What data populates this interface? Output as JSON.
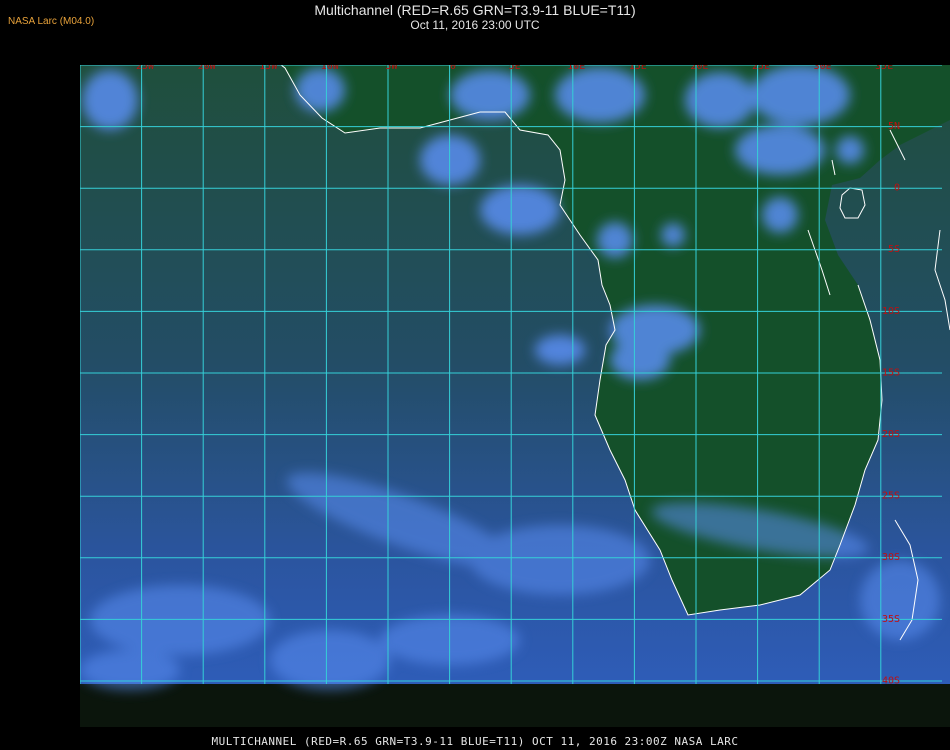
{
  "header": {
    "logo_text": "NASA Larc (M04.0)",
    "title_line1": "Multichannel (RED=R.65 GRN=T3.9-11 BLUE=T11)",
    "title_line2": "Oct 11, 2016 23:00 UTC"
  },
  "footer": {
    "caption": "MULTICHANNEL (RED=R.65 GRN=T3.9-11 BLUE=T11) OCT 11, 2016 23:00Z   NASA LARC"
  },
  "map": {
    "longitude_labels": [
      "25W",
      "20W",
      "15W",
      "10W",
      "5W",
      "0",
      "5E",
      "10E",
      "15E",
      "20E",
      "25E",
      "30E",
      "35E"
    ],
    "latitude_labels": [
      "5N",
      "0",
      "5S",
      "10S",
      "15S",
      "20S",
      "25S",
      "30S",
      "35S",
      "40S"
    ],
    "colors": {
      "grid": "#35d0d8",
      "coastline": "#ffffff",
      "label": "#c01010",
      "land": "#16502a",
      "ocean_north": "#1d4a3a",
      "ocean_south": "#2a55a8",
      "cloud": "#5b8ef0"
    }
  }
}
